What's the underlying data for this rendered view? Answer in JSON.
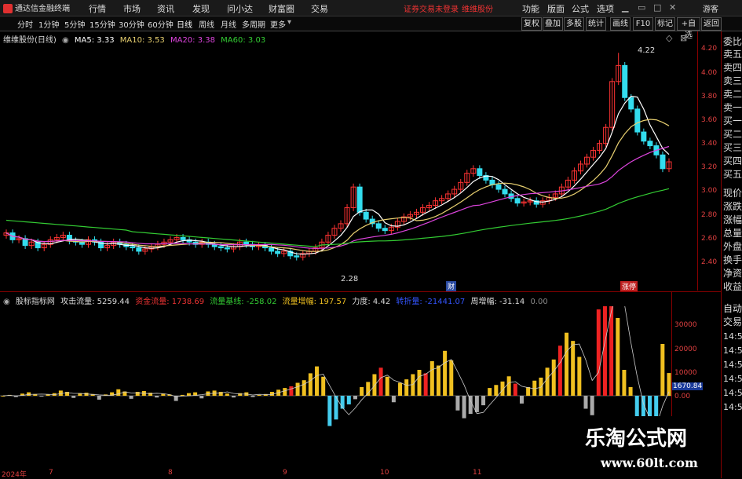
{
  "menubar": {
    "app_title": "通达信金融终端",
    "items": [
      "行情",
      "市场",
      "资讯",
      "发现",
      "问小达",
      "财富圈",
      "交易"
    ],
    "notice": "证券交易未登录",
    "stock_link": "维维股份",
    "right_items": [
      "功能",
      "版面",
      "公式",
      "选项"
    ],
    "guest": "游客"
  },
  "timeframes": [
    "分时",
    "1分钟",
    "5分钟",
    "15分钟",
    "30分钟",
    "60分钟",
    "日线",
    "周线",
    "月线",
    "多周期",
    "更多"
  ],
  "toolbar_buttons": [
    "复权",
    "叠加",
    "多股",
    "统计",
    "画线",
    "F10",
    "标记",
    "+自选",
    "返回"
  ],
  "main_chart": {
    "stock_name": "维维股份(日线)",
    "ma5_label": "MA5: 3.33",
    "ma10_label": "MA10: 3.53",
    "ma20_label": "MA20: 3.38",
    "ma60_label": "MA60: 3.03",
    "high_label": "4.22",
    "low_label": "2.28",
    "marker_cai": "财",
    "marker_zhangting": "涨停",
    "price_axis": [
      "4.20",
      "4.00",
      "3.80",
      "3.60",
      "3.40",
      "3.20",
      "3.00",
      "2.80",
      "2.60",
      "2.40"
    ]
  },
  "sub_chart": {
    "indicator_name": "股标指标网",
    "attack_flow": "攻击流量: 5259.44",
    "fund_flow": "资金流量: 1738.69",
    "flow_base": "流量基线: -258.02",
    "flow_increase": "流量增幅: 197.57",
    "strength": "力度: 4.42",
    "turnover": "转折量: -21441.07",
    "week_increase": "周增幅: -31.14",
    "zero": "0.00",
    "axis": [
      "30000",
      "20000",
      "10000",
      "0.00"
    ],
    "current_value": "1670.84"
  },
  "right_panel": {
    "top": [
      "委比",
      "卖五",
      "卖四",
      "卖三",
      "卖二",
      "卖一",
      "买一",
      "买二",
      "买三",
      "买四",
      "买五",
      "现价",
      "涨跌",
      "涨幅",
      "总量",
      "外盘",
      "换手",
      "净资",
      "收益"
    ],
    "bottom": [
      "自动",
      "交易",
      "14:5",
      "14:5",
      "14:5",
      "14:5",
      "14:5",
      "14:5"
    ]
  },
  "dates": [
    "2024年",
    "7",
    "8",
    "9",
    "10",
    "11"
  ],
  "watermark": {
    "title": "乐淘公式网",
    "url": "www.60lt.com"
  },
  "colors": {
    "up": "#ff3333",
    "down": "#33ddee",
    "ma5": "#ffffff",
    "ma10": "#e8d070",
    "ma20": "#dd44dd",
    "ma60": "#33cc33",
    "bar_yellow": "#f0c020",
    "bar_red": "#ee2222",
    "bar_cyan": "#44ccee",
    "bar_gray": "#aaaaaa"
  },
  "chart_data": {
    "type": "candlestick",
    "price_ylim": [
      2.28,
      4.3
    ],
    "price_close": [
      2.68,
      2.62,
      2.63,
      2.57,
      2.6,
      2.55,
      2.58,
      2.62,
      2.64,
      2.66,
      2.61,
      2.6,
      2.58,
      2.62,
      2.6,
      2.55,
      2.57,
      2.6,
      2.58,
      2.56,
      2.55,
      2.52,
      2.54,
      2.56,
      2.58,
      2.6,
      2.62,
      2.64,
      2.62,
      2.6,
      2.58,
      2.6,
      2.58,
      2.56,
      2.55,
      2.54,
      2.56,
      2.6,
      2.58,
      2.56,
      2.57,
      2.55,
      2.52,
      2.5,
      2.52,
      2.48,
      2.47,
      2.5,
      2.52,
      2.55,
      2.6,
      2.66,
      2.72,
      2.76,
      2.9,
      3.08,
      2.86,
      2.8,
      2.76,
      2.72,
      2.7,
      2.73,
      2.78,
      2.82,
      2.84,
      2.86,
      2.9,
      2.92,
      2.96,
      2.98,
      3.02,
      3.06,
      3.12,
      3.2,
      3.24,
      3.18,
      3.14,
      3.1,
      3.06,
      3.02,
      2.98,
      2.94,
      2.95,
      2.96,
      2.93,
      2.96,
      2.99,
      3.02,
      3.08,
      3.14,
      3.22,
      3.28,
      3.34,
      3.4,
      3.46,
      3.6,
      4.0,
      4.14,
      3.86,
      3.76,
      3.56,
      3.48,
      3.44,
      3.36,
      3.24,
      3.3
    ],
    "sub_values": [
      0,
      200,
      -300,
      500,
      800,
      400,
      -200,
      300,
      600,
      1200,
      900,
      -500,
      600,
      700,
      400,
      -900,
      300,
      800,
      1500,
      1000,
      -700,
      900,
      1100,
      700,
      -400,
      500,
      300,
      -1200,
      200,
      600,
      800,
      -600,
      1000,
      1200,
      900,
      500,
      -400,
      600,
      800,
      -300,
      200,
      400,
      900,
      1400,
      1800,
      2200,
      3000,
      3600,
      5200,
      6800,
      4400,
      -7000,
      -5500,
      -3000,
      -2000,
      -800,
      2000,
      3200,
      5000,
      6500,
      4400,
      -1500,
      3000,
      3800,
      5000,
      6000,
      5200,
      8000,
      7000,
      10400,
      8200,
      -3400,
      -5200,
      -4200,
      -3800,
      -2200,
      1800,
      2500,
      3300,
      4500,
      2800,
      -1800,
      2000,
      3500,
      4200,
      6500,
      8400,
      11600,
      14600,
      12700,
      9000,
      -3000,
      -4500,
      20000,
      37600,
      25000,
      18000,
      6000,
      2000,
      -7000,
      -8200,
      -7500,
      -6000,
      12000,
      5259
    ]
  }
}
